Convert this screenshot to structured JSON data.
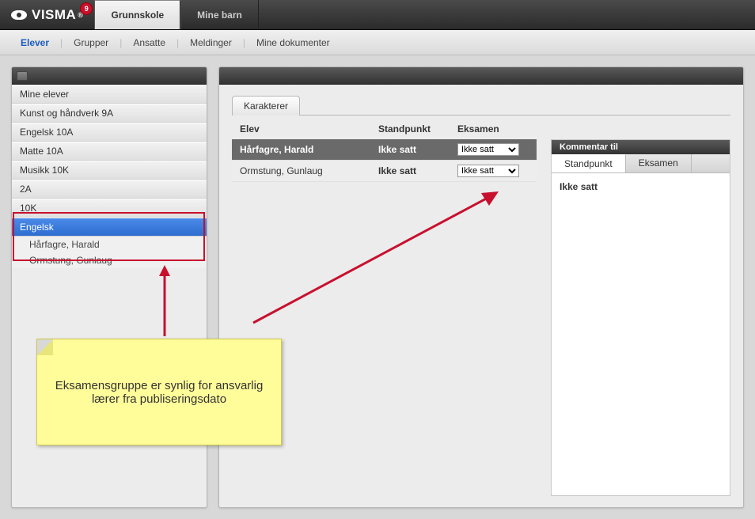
{
  "logo": {
    "text": "VISMA",
    "badge": "9"
  },
  "top_tabs": [
    {
      "label": "Grunnskole",
      "active": true
    },
    {
      "label": "Mine barn",
      "active": false
    }
  ],
  "subnav": [
    {
      "label": "Elever",
      "active": true
    },
    {
      "label": "Grupper"
    },
    {
      "label": "Ansatte"
    },
    {
      "label": "Meldinger"
    },
    {
      "label": "Mine dokumenter"
    }
  ],
  "sidebar": {
    "items": [
      "Mine elever",
      "Kunst og håndverk 9A",
      "Engelsk 10A",
      "Matte 10A",
      "Musikk 10K",
      "2A",
      "10K",
      "Engelsk"
    ],
    "selected_index": 7,
    "sub_items": [
      "Hårfagre, Harald",
      "Ormstung, Gunlaug"
    ]
  },
  "main": {
    "tab": "Karakterer",
    "col_elev": "Elev",
    "col_stp": "Standpunkt",
    "col_eks": "Eksamen",
    "rows": [
      {
        "name": "Hårfagre, Harald",
        "standpunkt": "Ikke satt",
        "eksamen": "Ikke satt",
        "selected": true
      },
      {
        "name": "Ormstung, Gunlaug",
        "standpunkt": "Ikke satt",
        "eksamen": "Ikke satt",
        "selected": false
      }
    ]
  },
  "right": {
    "title": "Kommentar til",
    "tabs": [
      "Standpunkt",
      "Eksamen"
    ],
    "active_tab": 0,
    "body": "Ikke satt"
  },
  "note": "Eksamensgruppe er synlig for ansvarlig lærer fra publiseringsdato"
}
